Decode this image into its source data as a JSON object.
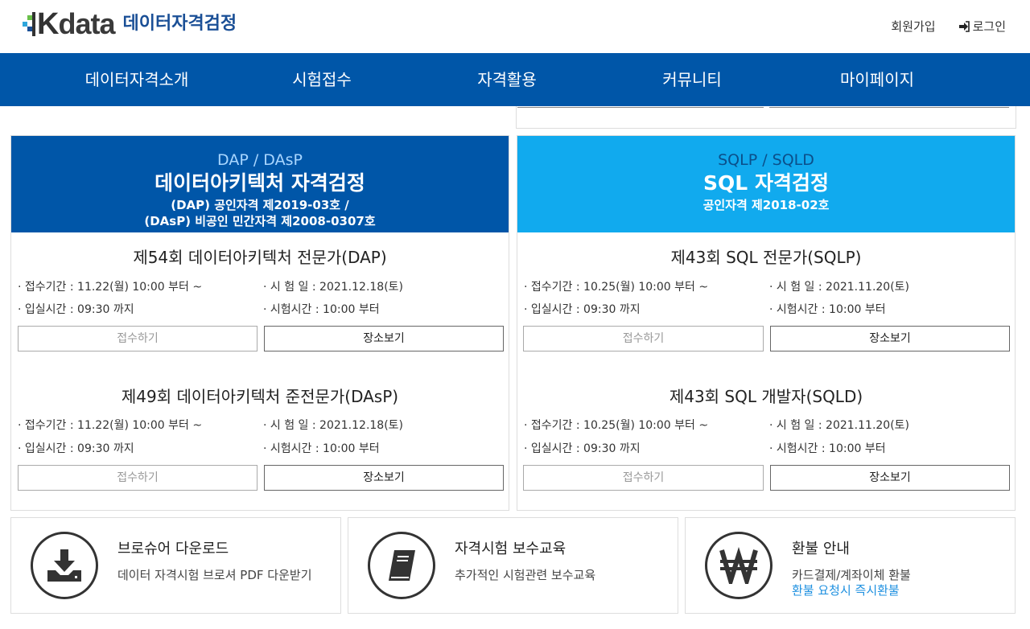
{
  "header": {
    "logo_k": "K",
    "logo_data": "data",
    "logo_sub": "데이터자격검정",
    "signup": "회원가입",
    "login": "로그인"
  },
  "nav": [
    "데이터자격소개",
    "시험접수",
    "자격활용",
    "커뮤니티",
    "마이페이지"
  ],
  "left_panel": {
    "code": "DAP / DAsP",
    "title": "데이터아키텍처 자격검정",
    "sub1": "(DAP) 공인자격 제2019-03호 /",
    "sub2": "(DAsP) 비공인 민간자격 제2008-0307호",
    "exams": [
      {
        "title": "제54회 데이터아키텍처 전문가(DAP)",
        "reg": "· 접수기간 : 11.22(월) 10:00 부터 ~",
        "date": "· 시 험 일  : 2021.12.18(토)",
        "entry": "· 입실시간 : 09:30 까지",
        "time": "· 시험시간 : 10:00 부터",
        "apply": "접수하기",
        "site": "장소보기"
      },
      {
        "title": "제49회 데이터아키텍처 준전문가(DAsP)",
        "reg": "· 접수기간 : 11.22(월) 10:00 부터 ~",
        "date": "· 시 험 일  : 2021.12.18(토)",
        "entry": "· 입실시간 : 09:30 까지",
        "time": "· 시험시간 : 10:00 부터",
        "apply": "접수하기",
        "site": "장소보기"
      }
    ]
  },
  "right_panel": {
    "code": "SQLP / SQLD",
    "title": "SQL 자격검정",
    "sub1": "공인자격 제2018-02호",
    "exams": [
      {
        "title": "제43회 SQL 전문가(SQLP)",
        "reg": "· 접수기간 : 10.25(월) 10:00 부터 ~",
        "date": "· 시 험 일  : 2021.11.20(토)",
        "entry": "· 입실시간 : 09:30 까지",
        "time": "· 시험시간 : 10:00 부터",
        "apply": "접수하기",
        "site": "장소보기"
      },
      {
        "title": "제43회 SQL 개발자(SQLD)",
        "reg": "· 접수기간 : 10.25(월) 10:00 부터 ~",
        "date": "· 시 험 일  : 2021.11.20(토)",
        "entry": "· 입실시간 : 09:30 까지",
        "time": "· 시험시간 : 10:00 부터",
        "apply": "접수하기",
        "site": "장소보기"
      }
    ]
  },
  "cards": [
    {
      "title": "브로슈어 다운로드",
      "desc": "데이터 자격시험 브로셔 PDF 다운받기",
      "link": "",
      "icon": "download-icon"
    },
    {
      "title": "자격시험 보수교육",
      "desc": "추가적인 시험관련 보수교육",
      "link": "",
      "icon": "book-icon"
    },
    {
      "title": "환불 안내",
      "desc": "카드결제/계좌이체 환불",
      "link": "환불 요청시 즉시환불",
      "icon": "won-icon"
    }
  ],
  "colors": {
    "nav": "#0056a8",
    "dap_head": "#0056a8",
    "sql_head": "#11aaee",
    "link": "#1e90e0"
  }
}
